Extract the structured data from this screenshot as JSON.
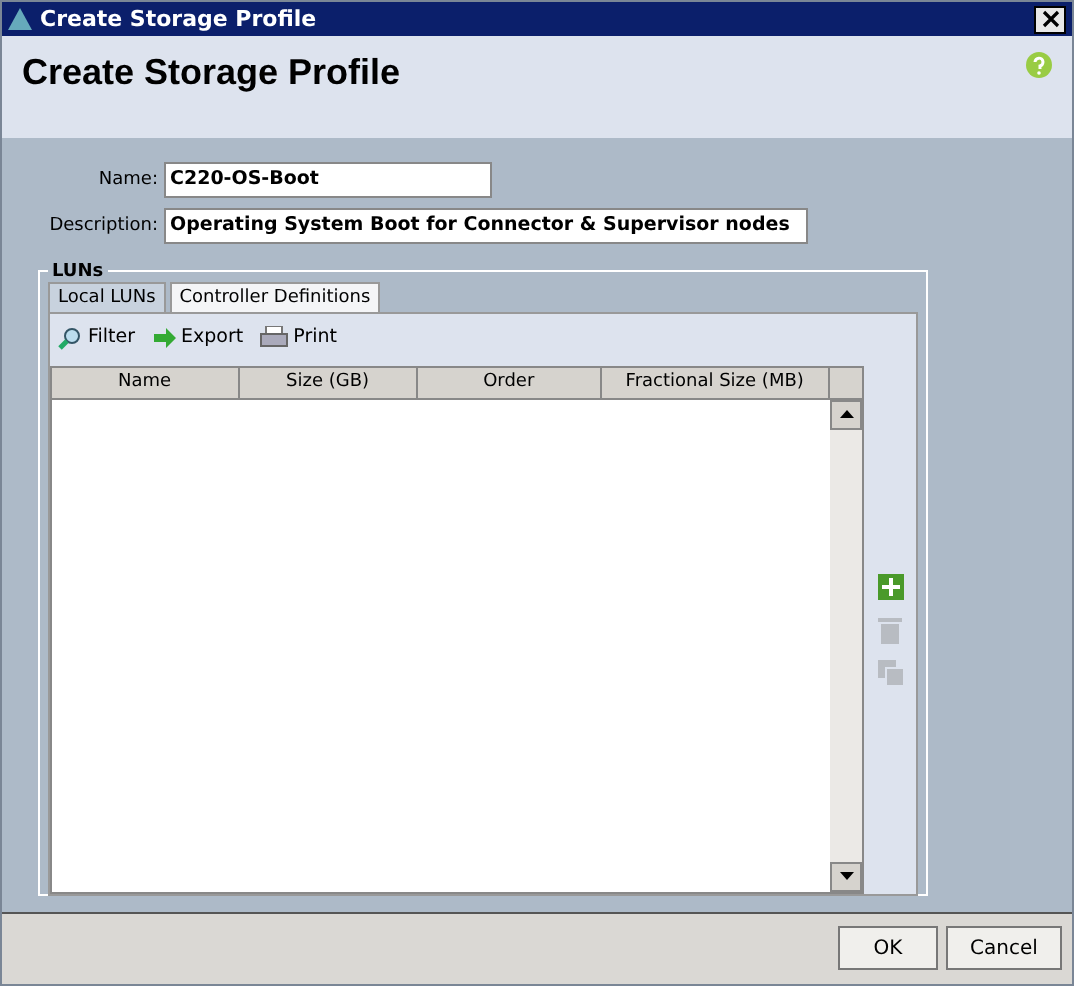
{
  "window": {
    "title": "Create Storage Profile"
  },
  "header": {
    "title": "Create Storage Profile"
  },
  "form": [
    {
      "label": "Name:",
      "value": "C220-OS-Boot"
    },
    {
      "label": "Description:",
      "value": "Operating System Boot for Connector & Supervisor nodes"
    }
  ],
  "luns": {
    "legend": "LUNs",
    "tabs": [
      {
        "label": "Local LUNs",
        "selected": true
      },
      {
        "label": "Controller Definitions",
        "selected": false
      }
    ],
    "toolbar": [
      {
        "kind": "filter",
        "label": "Filter"
      },
      {
        "kind": "export",
        "label": "Export"
      },
      {
        "kind": "print",
        "label": "Print"
      }
    ],
    "table": {
      "columns": [
        "Name",
        "Size (GB)",
        "Order",
        "Fractional Size (MB)"
      ]
    },
    "actions": [
      {
        "kind": "add",
        "disabled": false
      },
      {
        "kind": "delete",
        "disabled": true
      },
      {
        "kind": "copy",
        "disabled": true
      }
    ]
  },
  "buttons": [
    "OK",
    "Cancel"
  ]
}
